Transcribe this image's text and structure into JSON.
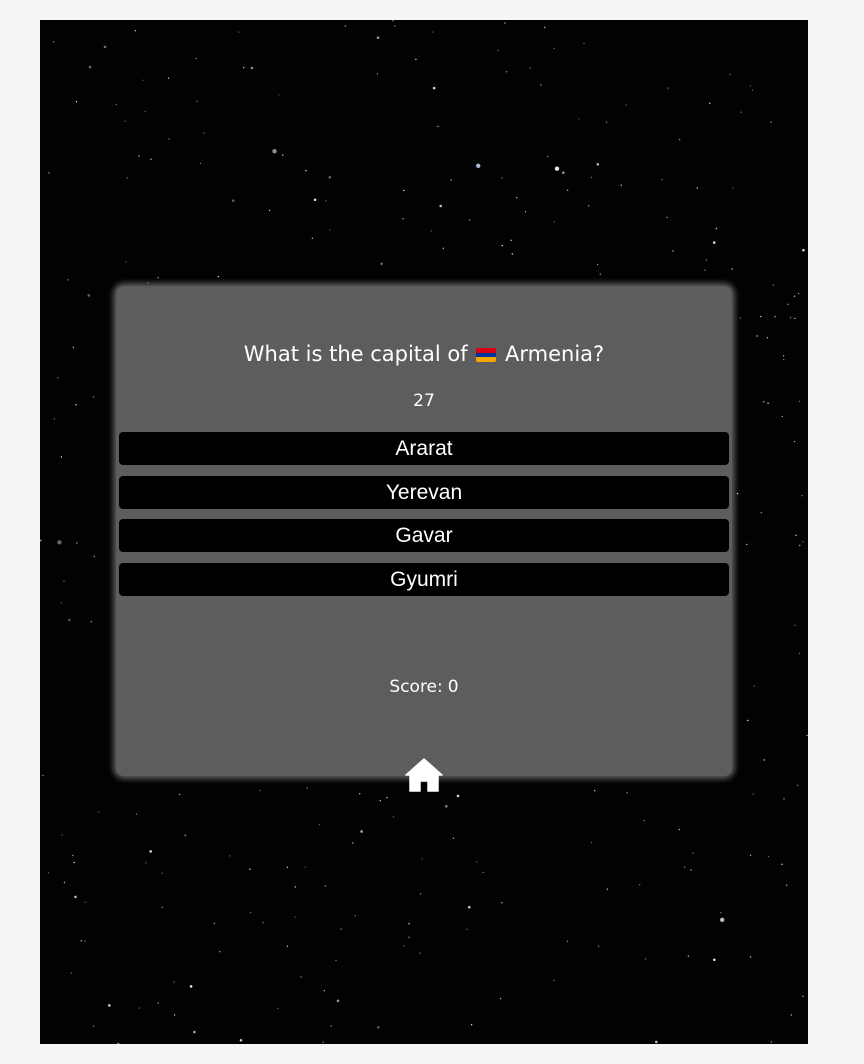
{
  "quiz": {
    "question_prefix": "What is the capital of",
    "country": "Armenia?",
    "flag_icon": "armenia-flag-icon",
    "flag_colors": [
      "#d90012",
      "#0033a0",
      "#f2a800"
    ],
    "timer": "27",
    "answers": [
      {
        "label": "Ararat"
      },
      {
        "label": "Yerevan"
      },
      {
        "label": "Gavar"
      },
      {
        "label": "Gyumri"
      }
    ],
    "score_label": "Score:",
    "score_value": "0",
    "home_icon": "home-icon"
  },
  "colors": {
    "background": "#020202",
    "card": "#5d5d5d",
    "button": "#000000",
    "text": "#ffffff"
  }
}
